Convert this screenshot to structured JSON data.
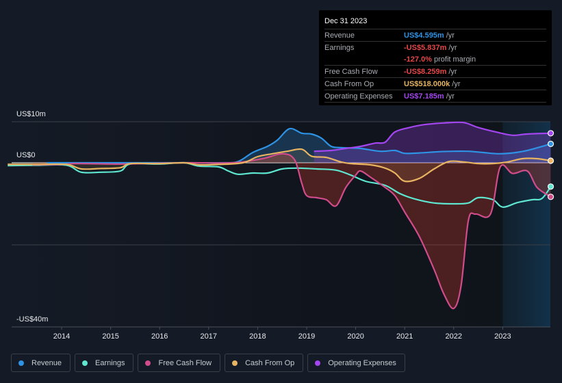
{
  "tooltip": {
    "date": "Dec 31 2023",
    "rows": [
      {
        "label": "Revenue",
        "value": "US$4.595m",
        "unit": "/yr",
        "color": "#2e93e5"
      },
      {
        "label": "Earnings",
        "value": "-US$5.837m",
        "unit": "/yr",
        "color": "#e64848"
      },
      {
        "label": "",
        "value": "-127.0%",
        "unit": "profit margin",
        "color": "#e64848"
      },
      {
        "label": "Free Cash Flow",
        "value": "-US$8.259m",
        "unit": "/yr",
        "color": "#e64848"
      },
      {
        "label": "Cash From Op",
        "value": "US$518.000k",
        "unit": "/yr",
        "color": "#e8b461"
      },
      {
        "label": "Operating Expenses",
        "value": "US$7.185m",
        "unit": "/yr",
        "color": "#a346f0"
      }
    ]
  },
  "legend": [
    {
      "label": "Revenue",
      "color": "#2e93e5"
    },
    {
      "label": "Earnings",
      "color": "#5ee6d0"
    },
    {
      "label": "Free Cash Flow",
      "color": "#d04c8c"
    },
    {
      "label": "Cash From Op",
      "color": "#e8b461"
    },
    {
      "label": "Operating Expenses",
      "color": "#a346f0"
    }
  ],
  "chart_data": {
    "type": "area",
    "title": "",
    "xlabel": "",
    "ylabel": "",
    "ylim": [
      -40,
      10
    ],
    "y_unit": "US$m",
    "y_tick_labels": [
      {
        "value": 10,
        "label": "US$10m"
      },
      {
        "value": 0,
        "label": "US$0"
      },
      {
        "value": -40,
        "label": "-US$40m"
      }
    ],
    "gridlines": [
      10,
      0,
      -20
    ],
    "xlim": [
      2013.0,
      2024.0
    ],
    "x_ticks": [
      2014,
      2015,
      2016,
      2017,
      2018,
      2019,
      2020,
      2021,
      2022,
      2023
    ],
    "forecast_shade_from": 2023.0,
    "legend_position": "bottom",
    "series": [
      {
        "name": "Revenue",
        "color": "#2e93e5",
        "points": [
          [
            2013.7,
            0
          ],
          [
            2014.5,
            0
          ],
          [
            2015.5,
            0
          ],
          [
            2016.5,
            0
          ],
          [
            2017.3,
            0
          ],
          [
            2017.6,
            0.3
          ],
          [
            2017.9,
            2.5
          ],
          [
            2018.2,
            4
          ],
          [
            2018.4,
            5.5
          ],
          [
            2018.65,
            8.3
          ],
          [
            2018.9,
            7.2
          ],
          [
            2019.1,
            7
          ],
          [
            2019.3,
            6
          ],
          [
            2019.5,
            4
          ],
          [
            2019.7,
            3.7
          ],
          [
            2019.9,
            3.6
          ],
          [
            2020.1,
            3.5
          ],
          [
            2020.5,
            2.8
          ],
          [
            2020.8,
            3
          ],
          [
            2021.0,
            2.3
          ],
          [
            2021.3,
            2.4
          ],
          [
            2021.7,
            2.7
          ],
          [
            2022.0,
            2.8
          ],
          [
            2022.3,
            2.8
          ],
          [
            2022.6,
            2.5
          ],
          [
            2022.9,
            2.2
          ],
          [
            2023.2,
            2.4
          ],
          [
            2023.5,
            3
          ],
          [
            2023.98,
            4.6
          ]
        ]
      },
      {
        "name": "Earnings",
        "color": "#5ee6d0",
        "points": [
          [
            2012.9,
            -0.7
          ],
          [
            2013.5,
            -0.6
          ],
          [
            2014.1,
            -0.6
          ],
          [
            2014.4,
            -2.3
          ],
          [
            2014.8,
            -2.3
          ],
          [
            2015.2,
            -2
          ],
          [
            2015.4,
            -0.3
          ],
          [
            2016.0,
            -0.3
          ],
          [
            2016.5,
            0
          ],
          [
            2016.8,
            -0.8
          ],
          [
            2017.2,
            -1
          ],
          [
            2017.4,
            -2
          ],
          [
            2017.6,
            -2.8
          ],
          [
            2017.9,
            -2.5
          ],
          [
            2018.2,
            -2.5
          ],
          [
            2018.5,
            -1.5
          ],
          [
            2018.8,
            -1.3
          ],
          [
            2019.2,
            -1.5
          ],
          [
            2019.6,
            -1.8
          ],
          [
            2019.9,
            -3
          ],
          [
            2020.2,
            -4.5
          ],
          [
            2020.6,
            -5.5
          ],
          [
            2020.9,
            -7.5
          ],
          [
            2021.2,
            -8.8
          ],
          [
            2021.6,
            -9.8
          ],
          [
            2022.0,
            -10
          ],
          [
            2022.3,
            -9.8
          ],
          [
            2022.5,
            -8.5
          ],
          [
            2022.8,
            -9
          ],
          [
            2023.0,
            -10.8
          ],
          [
            2023.3,
            -9.7
          ],
          [
            2023.6,
            -9
          ],
          [
            2023.8,
            -8.7
          ],
          [
            2023.98,
            -5.8
          ]
        ]
      },
      {
        "name": "Free Cash Flow",
        "color": "#d04c8c",
        "points": [
          [
            2013.4,
            -0.5
          ],
          [
            2014.0,
            -0.4
          ],
          [
            2014.3,
            -0.2
          ],
          [
            2015.0,
            -0.3
          ],
          [
            2015.3,
            -0.3
          ],
          [
            2016.5,
            0
          ],
          [
            2017.5,
            0
          ],
          [
            2018.1,
            1
          ],
          [
            2018.5,
            2.2
          ],
          [
            2018.75,
            0.8
          ],
          [
            2018.9,
            -5
          ],
          [
            2019.0,
            -8
          ],
          [
            2019.2,
            -8.5
          ],
          [
            2019.4,
            -9
          ],
          [
            2019.6,
            -10.5
          ],
          [
            2019.8,
            -6
          ],
          [
            2020.0,
            -3
          ],
          [
            2020.1,
            -2
          ],
          [
            2020.3,
            -3.5
          ],
          [
            2020.6,
            -6
          ],
          [
            2020.8,
            -8
          ],
          [
            2021.0,
            -12
          ],
          [
            2021.3,
            -18
          ],
          [
            2021.6,
            -26
          ],
          [
            2021.8,
            -32
          ],
          [
            2022.0,
            -35.5
          ],
          [
            2022.15,
            -30
          ],
          [
            2022.3,
            -14
          ],
          [
            2022.45,
            -12.5
          ],
          [
            2022.75,
            -12.5
          ],
          [
            2022.95,
            -1
          ],
          [
            2023.2,
            -2.6
          ],
          [
            2023.5,
            -2
          ],
          [
            2023.7,
            -6
          ],
          [
            2023.98,
            -8.3
          ]
        ]
      },
      {
        "name": "Cash From Op",
        "color": "#e8b461",
        "points": [
          [
            2012.9,
            -0.4
          ],
          [
            2013.5,
            -0.4
          ],
          [
            2014.1,
            -0.4
          ],
          [
            2014.4,
            -1.5
          ],
          [
            2014.8,
            -1.4
          ],
          [
            2015.2,
            -1.2
          ],
          [
            2015.4,
            -0.2
          ],
          [
            2016.0,
            -0.2
          ],
          [
            2016.5,
            0
          ],
          [
            2016.8,
            -0.5
          ],
          [
            2017.2,
            -0.4
          ],
          [
            2017.7,
            0
          ],
          [
            2018.0,
            1.5
          ],
          [
            2018.3,
            2.2
          ],
          [
            2018.6,
            2.8
          ],
          [
            2018.9,
            3.3
          ],
          [
            2019.1,
            1.6
          ],
          [
            2019.4,
            1.3
          ],
          [
            2019.7,
            0.2
          ],
          [
            2019.9,
            -0.2
          ],
          [
            2020.3,
            -0.5
          ],
          [
            2020.6,
            -1.3
          ],
          [
            2020.8,
            -2.5
          ],
          [
            2021.0,
            -4.5
          ],
          [
            2021.3,
            -3.8
          ],
          [
            2021.6,
            -1.5
          ],
          [
            2021.9,
            0.3
          ],
          [
            2022.2,
            0.2
          ],
          [
            2022.5,
            -0.2
          ],
          [
            2022.8,
            -0.2
          ],
          [
            2023.1,
            0.2
          ],
          [
            2023.4,
            1
          ],
          [
            2023.7,
            1
          ],
          [
            2023.98,
            0.5
          ]
        ]
      },
      {
        "name": "Operating Expenses",
        "color": "#a346f0",
        "points": [
          [
            2019.15,
            2.8
          ],
          [
            2019.5,
            3
          ],
          [
            2019.8,
            3.5
          ],
          [
            2020.1,
            4
          ],
          [
            2020.4,
            4.8
          ],
          [
            2020.6,
            5
          ],
          [
            2020.8,
            7.5
          ],
          [
            2021.1,
            8.6
          ],
          [
            2021.4,
            9.3
          ],
          [
            2021.8,
            9.7
          ],
          [
            2022.2,
            9.8
          ],
          [
            2022.5,
            8.6
          ],
          [
            2022.9,
            7.4
          ],
          [
            2023.2,
            6.7
          ],
          [
            2023.5,
            7
          ],
          [
            2023.98,
            7.2
          ]
        ]
      }
    ]
  }
}
